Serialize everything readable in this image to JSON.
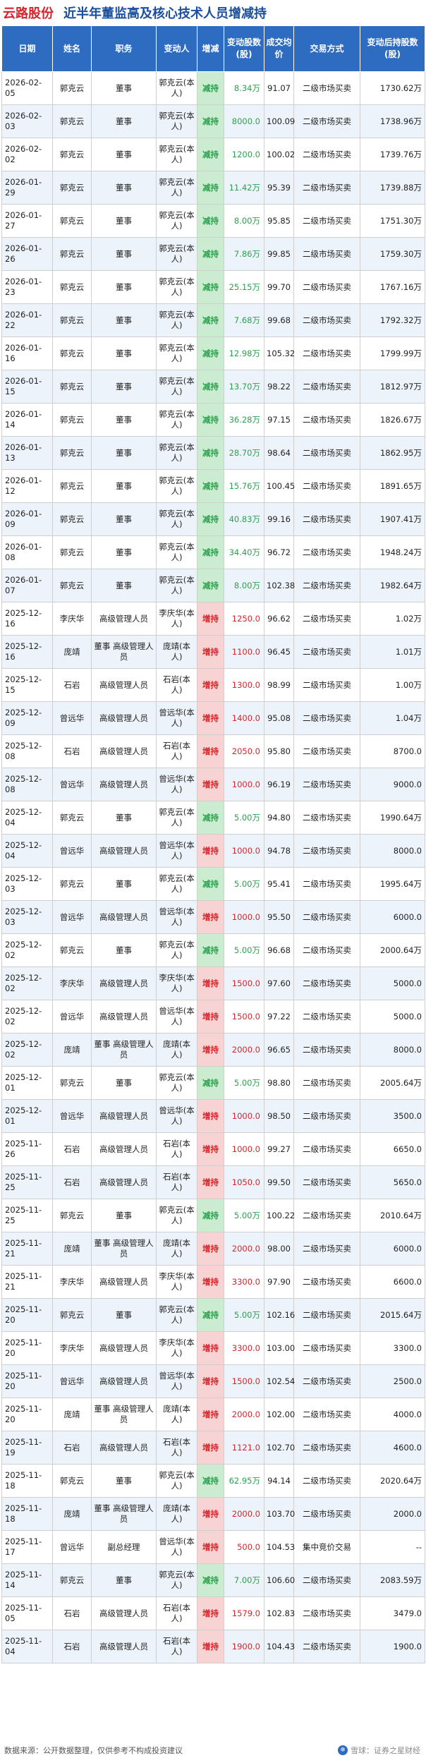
{
  "header": {
    "company": "云路股份",
    "title": "近半年董监高及核心技术人员增减持"
  },
  "columns": [
    "日期",
    "姓名",
    "职务",
    "变动人",
    "增减",
    "变动股数(股)",
    "成交均价",
    "交易方式",
    "变动后持股数(股)"
  ],
  "rows": [
    [
      "2026-02-05",
      "郭克云",
      "董事",
      "郭克云(本人)",
      "减持",
      "8.34万",
      "91.07",
      "二级市场买卖",
      "1730.62万"
    ],
    [
      "2026-02-03",
      "郭克云",
      "董事",
      "郭克云(本人)",
      "减持",
      "8000.0",
      "100.09",
      "二级市场买卖",
      "1738.96万"
    ],
    [
      "2026-02-02",
      "郭克云",
      "董事",
      "郭克云(本人)",
      "减持",
      "1200.0",
      "100.02",
      "二级市场买卖",
      "1739.76万"
    ],
    [
      "2026-01-29",
      "郭克云",
      "董事",
      "郭克云(本人)",
      "减持",
      "11.42万",
      "95.39",
      "二级市场买卖",
      "1739.88万"
    ],
    [
      "2026-01-27",
      "郭克云",
      "董事",
      "郭克云(本人)",
      "减持",
      "8.00万",
      "95.85",
      "二级市场买卖",
      "1751.30万"
    ],
    [
      "2026-01-26",
      "郭克云",
      "董事",
      "郭克云(本人)",
      "减持",
      "7.86万",
      "99.85",
      "二级市场买卖",
      "1759.30万"
    ],
    [
      "2026-01-23",
      "郭克云",
      "董事",
      "郭克云(本人)",
      "减持",
      "25.15万",
      "99.70",
      "二级市场买卖",
      "1767.16万"
    ],
    [
      "2026-01-22",
      "郭克云",
      "董事",
      "郭克云(本人)",
      "减持",
      "7.68万",
      "99.68",
      "二级市场买卖",
      "1792.32万"
    ],
    [
      "2026-01-16",
      "郭克云",
      "董事",
      "郭克云(本人)",
      "减持",
      "12.98万",
      "105.32",
      "二级市场买卖",
      "1799.99万"
    ],
    [
      "2026-01-15",
      "郭克云",
      "董事",
      "郭克云(本人)",
      "减持",
      "13.70万",
      "98.22",
      "二级市场买卖",
      "1812.97万"
    ],
    [
      "2026-01-14",
      "郭克云",
      "董事",
      "郭克云(本人)",
      "减持",
      "36.28万",
      "97.15",
      "二级市场买卖",
      "1826.67万"
    ],
    [
      "2026-01-13",
      "郭克云",
      "董事",
      "郭克云(本人)",
      "减持",
      "28.70万",
      "98.64",
      "二级市场买卖",
      "1862.95万"
    ],
    [
      "2026-01-12",
      "郭克云",
      "董事",
      "郭克云(本人)",
      "减持",
      "15.76万",
      "100.45",
      "二级市场买卖",
      "1891.65万"
    ],
    [
      "2026-01-09",
      "郭克云",
      "董事",
      "郭克云(本人)",
      "减持",
      "40.83万",
      "99.16",
      "二级市场买卖",
      "1907.41万"
    ],
    [
      "2026-01-08",
      "郭克云",
      "董事",
      "郭克云(本人)",
      "减持",
      "34.40万",
      "96.72",
      "二级市场买卖",
      "1948.24万"
    ],
    [
      "2026-01-07",
      "郭克云",
      "董事",
      "郭克云(本人)",
      "减持",
      "8.00万",
      "102.38",
      "二级市场买卖",
      "1982.64万"
    ],
    [
      "2025-12-16",
      "李庆华",
      "高级管理人员",
      "李庆华(本人)",
      "增持",
      "1250.0",
      "96.62",
      "二级市场买卖",
      "1.02万"
    ],
    [
      "2025-12-16",
      "庞靖",
      "董事 高级管理人员",
      "庞靖(本人)",
      "增持",
      "1100.0",
      "96.45",
      "二级市场买卖",
      "1.01万"
    ],
    [
      "2025-12-15",
      "石岩",
      "高级管理人员",
      "石岩(本人)",
      "增持",
      "1300.0",
      "98.99",
      "二级市场买卖",
      "1.00万"
    ],
    [
      "2025-12-09",
      "曾远华",
      "高级管理人员",
      "曾远华(本人)",
      "增持",
      "1400.0",
      "95.08",
      "二级市场买卖",
      "1.04万"
    ],
    [
      "2025-12-08",
      "石岩",
      "高级管理人员",
      "石岩(本人)",
      "增持",
      "2050.0",
      "95.80",
      "二级市场买卖",
      "8700.0"
    ],
    [
      "2025-12-08",
      "曾远华",
      "高级管理人员",
      "曾远华(本人)",
      "增持",
      "1000.0",
      "96.19",
      "二级市场买卖",
      "9000.0"
    ],
    [
      "2025-12-04",
      "郭克云",
      "董事",
      "郭克云(本人)",
      "减持",
      "5.00万",
      "94.80",
      "二级市场买卖",
      "1990.64万"
    ],
    [
      "2025-12-04",
      "曾远华",
      "高级管理人员",
      "曾远华(本人)",
      "增持",
      "1000.0",
      "94.78",
      "二级市场买卖",
      "8000.0"
    ],
    [
      "2025-12-03",
      "郭克云",
      "董事",
      "郭克云(本人)",
      "减持",
      "5.00万",
      "95.41",
      "二级市场买卖",
      "1995.64万"
    ],
    [
      "2025-12-03",
      "曾远华",
      "高级管理人员",
      "曾远华(本人)",
      "增持",
      "1000.0",
      "95.50",
      "二级市场买卖",
      "6000.0"
    ],
    [
      "2025-12-02",
      "郭克云",
      "董事",
      "郭克云(本人)",
      "减持",
      "5.00万",
      "96.68",
      "二级市场买卖",
      "2000.64万"
    ],
    [
      "2025-12-02",
      "李庆华",
      "高级管理人员",
      "李庆华(本人)",
      "增持",
      "1500.0",
      "97.60",
      "二级市场买卖",
      "5000.0"
    ],
    [
      "2025-12-02",
      "曾远华",
      "高级管理人员",
      "曾远华(本人)",
      "增持",
      "1500.0",
      "97.22",
      "二级市场买卖",
      "5000.0"
    ],
    [
      "2025-12-02",
      "庞靖",
      "董事 高级管理人员",
      "庞靖(本人)",
      "增持",
      "2000.0",
      "96.65",
      "二级市场买卖",
      "8000.0"
    ],
    [
      "2025-12-01",
      "郭克云",
      "董事",
      "郭克云(本人)",
      "减持",
      "5.00万",
      "98.80",
      "二级市场买卖",
      "2005.64万"
    ],
    [
      "2025-12-01",
      "曾远华",
      "高级管理人员",
      "曾远华(本人)",
      "增持",
      "1000.0",
      "98.50",
      "二级市场买卖",
      "3500.0"
    ],
    [
      "2025-11-26",
      "石岩",
      "高级管理人员",
      "石岩(本人)",
      "增持",
      "1000.0",
      "99.27",
      "二级市场买卖",
      "6650.0"
    ],
    [
      "2025-11-25",
      "石岩",
      "高级管理人员",
      "石岩(本人)",
      "增持",
      "1050.0",
      "99.50",
      "二级市场买卖",
      "5650.0"
    ],
    [
      "2025-11-25",
      "郭克云",
      "董事",
      "郭克云(本人)",
      "减持",
      "5.00万",
      "100.22",
      "二级市场买卖",
      "2010.64万"
    ],
    [
      "2025-11-21",
      "庞靖",
      "董事 高级管理人员",
      "庞靖(本人)",
      "增持",
      "2000.0",
      "98.00",
      "二级市场买卖",
      "6000.0"
    ],
    [
      "2025-11-21",
      "李庆华",
      "高级管理人员",
      "李庆华(本人)",
      "增持",
      "3300.0",
      "97.90",
      "二级市场买卖",
      "6600.0"
    ],
    [
      "2025-11-20",
      "郭克云",
      "董事",
      "郭克云(本人)",
      "减持",
      "5.00万",
      "102.16",
      "二级市场买卖",
      "2015.64万"
    ],
    [
      "2025-11-20",
      "李庆华",
      "高级管理人员",
      "李庆华(本人)",
      "增持",
      "3300.0",
      "103.00",
      "二级市场买卖",
      "3300.0"
    ],
    [
      "2025-11-20",
      "曾远华",
      "高级管理人员",
      "曾远华(本人)",
      "增持",
      "1500.0",
      "102.54",
      "二级市场买卖",
      "2500.0"
    ],
    [
      "2025-11-20",
      "庞靖",
      "董事 高级管理人员",
      "庞靖(本人)",
      "增持",
      "2000.0",
      "102.00",
      "二级市场买卖",
      "4000.0"
    ],
    [
      "2025-11-19",
      "石岩",
      "高级管理人员",
      "石岩(本人)",
      "增持",
      "1121.0",
      "102.70",
      "二级市场买卖",
      "4600.0"
    ],
    [
      "2025-11-18",
      "郭克云",
      "董事",
      "郭克云(本人)",
      "减持",
      "62.95万",
      "94.14",
      "二级市场买卖",
      "2020.64万"
    ],
    [
      "2025-11-18",
      "庞靖",
      "董事 高级管理人员",
      "庞靖(本人)",
      "增持",
      "2000.0",
      "103.70",
      "二级市场买卖",
      "2000.0"
    ],
    [
      "2025-11-17",
      "曾远华",
      "副总经理",
      "曾远华(本人)",
      "增持",
      "500.0",
      "104.53",
      "集中竞价交易",
      "--"
    ],
    [
      "2025-11-14",
      "郭克云",
      "董事",
      "郭克云(本人)",
      "减持",
      "7.00万",
      "106.60",
      "二级市场买卖",
      "2083.59万"
    ],
    [
      "2025-11-05",
      "石岩",
      "高级管理人员",
      "石岩(本人)",
      "增持",
      "1579.0",
      "102.83",
      "二级市场买卖",
      "3479.0"
    ],
    [
      "2025-11-04",
      "石岩",
      "高级管理人员",
      "石岩(本人)",
      "增持",
      "1900.0",
      "104.43",
      "二级市场买卖",
      "1900.0"
    ]
  ],
  "footer": {
    "source": "数据来源：公开数据整理，仅供参考不构成投资建议",
    "brand": "雪球：证券之星财经"
  },
  "colors": {
    "header_bg": "#2e6cc1",
    "decrease": "#2ba14d",
    "increase": "#d8232a"
  }
}
